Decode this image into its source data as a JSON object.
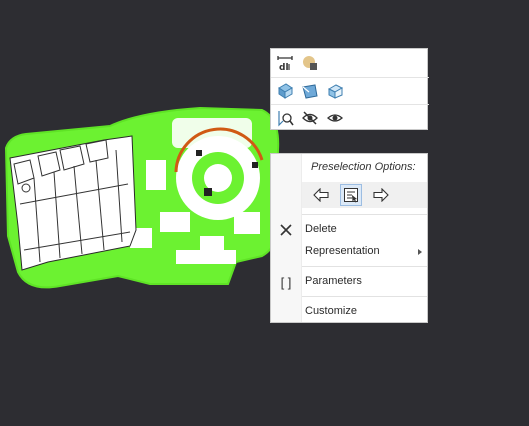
{
  "toolbar": {
    "row1": [
      {
        "icon": "measure-distance-icon"
      },
      {
        "icon": "appearance-icon"
      }
    ],
    "row2": [
      {
        "icon": "view-normal-icon"
      },
      {
        "icon": "orient-view-icon"
      },
      {
        "icon": "section-view-icon"
      }
    ],
    "row3": [
      {
        "icon": "zoom-to-selected-icon"
      },
      {
        "icon": "hide-icon"
      },
      {
        "icon": "show-icon"
      }
    ]
  },
  "context_menu": {
    "preselection_title": "Preselection Options:",
    "preselection_buttons": [
      {
        "icon": "previous-arrow-icon"
      },
      {
        "icon": "pick-from-list-icon",
        "selected": true
      },
      {
        "icon": "next-arrow-icon"
      }
    ],
    "items": [
      {
        "label": "Delete",
        "icon": "delete-x-icon"
      },
      {
        "label": "Representation",
        "submenu": true
      },
      {
        "label": "Parameters",
        "icon": "parameters-brackets-icon",
        "icon_glyph": "[ ]"
      },
      {
        "label": "Customize"
      }
    ]
  },
  "colors": {
    "background": "#2d2d32",
    "highlight": "#6cf231",
    "preselect_edge": "#d05a14",
    "menu_bg": "#ffffff"
  }
}
